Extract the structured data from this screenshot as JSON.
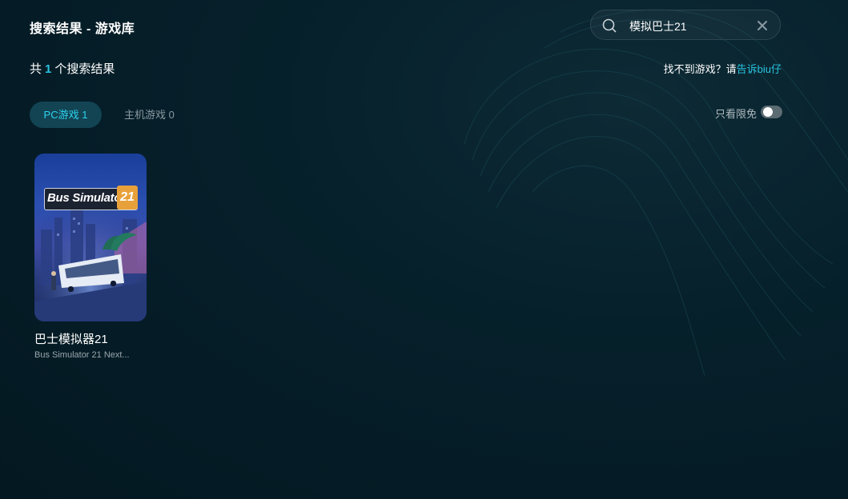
{
  "header": {
    "title": "搜索结果 - 游戏库"
  },
  "search": {
    "value": "模拟巴士21"
  },
  "results": {
    "prefix": "共",
    "count": "1",
    "suffix": "个搜索结果"
  },
  "help": {
    "text": "找不到游戏？请",
    "link": "告诉biu仔"
  },
  "tabs": [
    {
      "label": "PC游戏 1",
      "active": true
    },
    {
      "label": "主机游戏 0",
      "active": false
    }
  ],
  "filter": {
    "label": "只看限免",
    "on": false
  },
  "games": [
    {
      "title": "巴士模拟器21",
      "subtitle": "Bus Simulator 21 Next...",
      "cover_logo_text": "Bus Simulator",
      "cover_logo_number": "21"
    }
  ],
  "colors": {
    "accent": "#29c3e0",
    "tab_active_bg": "#124453",
    "background": "#06202b"
  },
  "icons": {
    "search": "search-icon",
    "clear": "clear-icon"
  }
}
